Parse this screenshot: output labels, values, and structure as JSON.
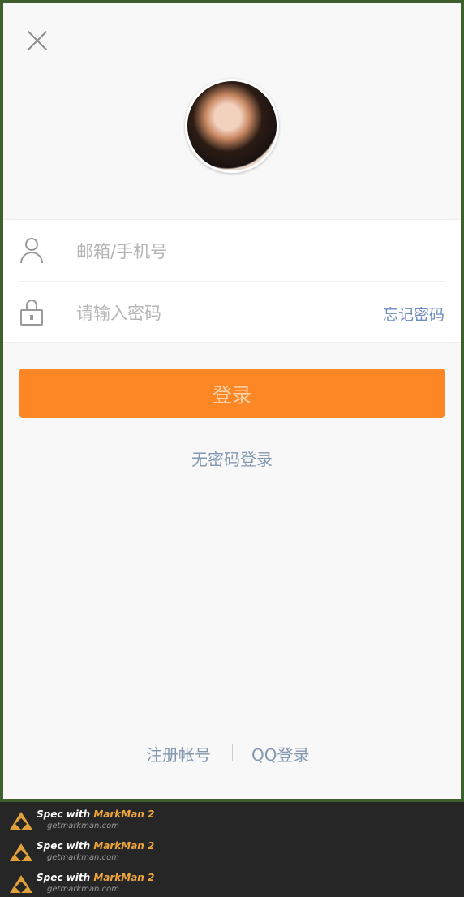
{
  "form": {
    "account_placeholder": "邮箱/手机号",
    "password_placeholder": "请输入密码",
    "forgot_label": "忘记密码"
  },
  "actions": {
    "login_label": "登录",
    "passwordless_label": "无密码登录"
  },
  "footer": {
    "register_label": "注册帐号",
    "qq_login_label": "QQ登录"
  },
  "spec": {
    "items": [
      {
        "prefix": "Spec with ",
        "brand": "MarkMan 2",
        "url": "getmarkman.com"
      },
      {
        "prefix": "Spec with ",
        "brand": "MarkMan 2",
        "url": "getmarkman.com"
      },
      {
        "prefix": "Spec with ",
        "brand": "MarkMan 2",
        "url": "getmarkman.com"
      }
    ]
  },
  "colors": {
    "primary_button": "#fd8625",
    "link_text": "#8398b0",
    "background": "#f8f8f8"
  },
  "icons": [
    "close-icon",
    "avatar-image",
    "user-icon",
    "lock-icon",
    "markman-logo-icon"
  ]
}
